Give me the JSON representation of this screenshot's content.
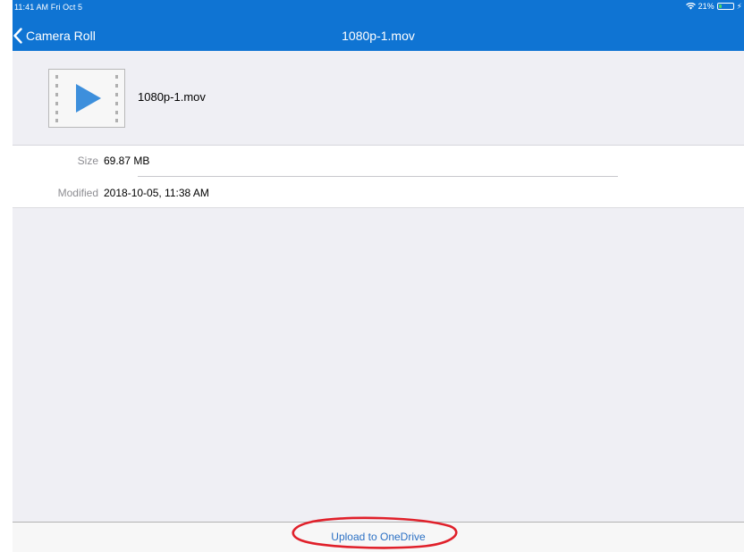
{
  "status_bar": {
    "time": "11:41 AM  Fri Oct 5",
    "battery_percent": "21%",
    "battery_level": 0.21,
    "icons": [
      "wifi-icon",
      "battery-icon",
      "charging-bolt-icon"
    ]
  },
  "nav": {
    "back_label": "Camera Roll",
    "title": "1080p-1.mov",
    "back_icon": "chevron-left-icon"
  },
  "file": {
    "name": "1080p-1.mov",
    "thumbnail_icon": "video-file-icon"
  },
  "details": [
    {
      "label": "Size",
      "value": "69.87 MB"
    },
    {
      "label": "Modified",
      "value": "2018-10-05, 11:38 AM"
    }
  ],
  "toolbar": {
    "upload_label": "Upload to OneDrive"
  },
  "colors": {
    "accent": "#0f74d3",
    "link": "#2b70c4",
    "background": "#efeff4",
    "annotation": "#e0202a"
  }
}
